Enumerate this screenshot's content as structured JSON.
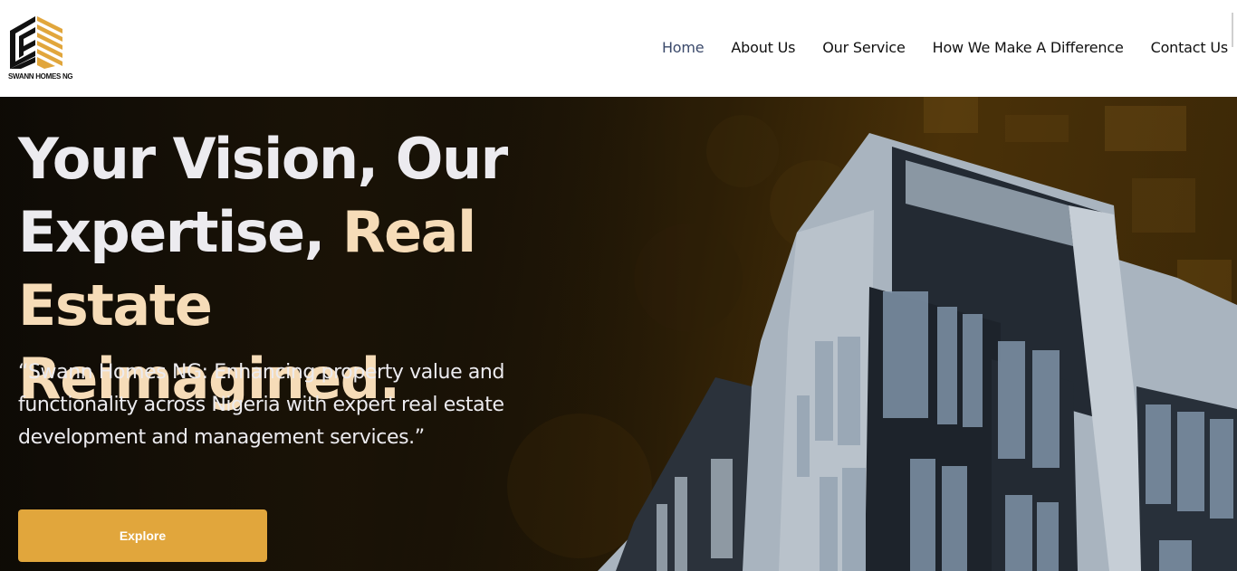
{
  "brand": {
    "name": "SWANN HOMES NG",
    "logo_icon": "stacked-stripes-logo-icon",
    "colors": {
      "accent": "#e1a63c",
      "headline_accent": "#f6dcb8",
      "nav_active": "#3b4a6b"
    }
  },
  "nav": {
    "items": [
      {
        "label": "Home",
        "active": true
      },
      {
        "label": "About Us",
        "active": false
      },
      {
        "label": "Our Service",
        "active": false
      },
      {
        "label": "How We Make A Difference",
        "active": false
      },
      {
        "label": "Contact Us",
        "active": false
      }
    ]
  },
  "hero": {
    "headline_plain_1": "Your Vision, Our",
    "headline_plain_2": "Expertise,",
    "headline_accent_1": "Real Estate",
    "headline_accent_2": "Reimagined.",
    "subtext": "“Swann Homes NG: Enhancing property value and functionality across Nigeria with expert real estate development and management services.”",
    "cta_label": "Explore",
    "background_image": "modern-apartment-building-photo"
  }
}
